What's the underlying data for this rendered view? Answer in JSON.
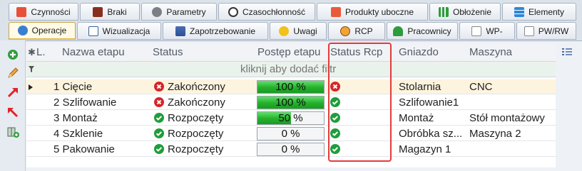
{
  "tabs_row1": [
    {
      "label": "Czynności",
      "icon": "list-icon"
    },
    {
      "label": "Braki",
      "icon": "toolbox-icon"
    },
    {
      "label": "Parametry",
      "icon": "gears-icon"
    },
    {
      "label": "Czasochłonność",
      "icon": "stopwatch-icon"
    },
    {
      "label": "Produkty uboczne",
      "icon": "magnet-icon"
    },
    {
      "label": "Obłożenie",
      "icon": "bar-chart-icon"
    },
    {
      "label": "Elementy",
      "icon": "stack-icon"
    }
  ],
  "tabs_row2": [
    {
      "label": "Operacje",
      "icon": "operations-icon",
      "active": true
    },
    {
      "label": "Wizualizacja",
      "icon": "window-icon"
    },
    {
      "label": "Zapotrzebowanie",
      "icon": "layers-icon"
    },
    {
      "label": "Uwagi",
      "icon": "warning-icon"
    },
    {
      "label": "RCP",
      "icon": "clock-icon"
    },
    {
      "label": "Pracownicy",
      "icon": "user-icon"
    },
    {
      "label": "WP-",
      "icon": "document-icon"
    },
    {
      "label": "PW/RW",
      "icon": "document-icon"
    }
  ],
  "grid": {
    "columns": {
      "lp": "L.",
      "name": "Nazwa etapu",
      "status": "Status",
      "progress": "Postęp etapu",
      "status_rcp": "Status Rcp",
      "nest": "Gniazdo",
      "machine": "Maszyna"
    },
    "filter_hint": "kliknij aby dodać filtr",
    "rows": [
      {
        "name": "1 Cięcie",
        "status": "Zakończony",
        "status_kind": "error",
        "progress_label": "100 %",
        "progress": 100,
        "rcp_kind": "error",
        "nest": "Stolarnia",
        "machine": "CNC"
      },
      {
        "name": "2 Szlifowanie",
        "status": "Zakończony",
        "status_kind": "error",
        "progress_label": "100 %",
        "progress": 100,
        "rcp_kind": "ok",
        "nest": "Szlifowanie1",
        "machine": ""
      },
      {
        "name": "3 Montaż",
        "status": "Rozpoczęty",
        "status_kind": "ok",
        "progress_label": "50 %",
        "progress": 50,
        "rcp_kind": "ok",
        "nest": "Montaż",
        "machine": "Stół montażowy"
      },
      {
        "name": "4 Szklenie",
        "status": "Rozpoczęty",
        "status_kind": "ok",
        "progress_label": "0 %",
        "progress": 0,
        "rcp_kind": "ok",
        "nest": "Obróbka sz...",
        "machine": "Maszyna 2"
      },
      {
        "name": "5 Pakowanie",
        "status": "Rozpoczęty",
        "status_kind": "ok",
        "progress_label": "0 %",
        "progress": 0,
        "rcp_kind": "ok",
        "nest": "Magazyn 1",
        "machine": ""
      }
    ]
  },
  "colors": {
    "ok": "#1f9d3b",
    "error": "#d6252a",
    "highlight_border": "#e23b3b",
    "progress_fill": "#23b02c"
  }
}
